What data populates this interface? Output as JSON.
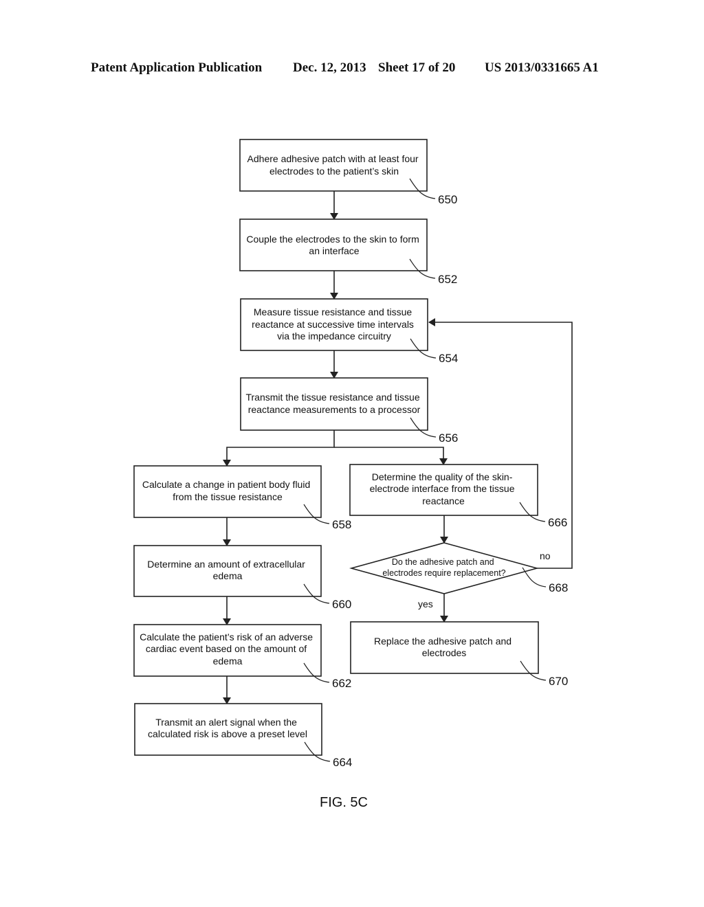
{
  "header": {
    "publication": "Patent Application Publication",
    "date": "Dec. 12, 2013",
    "sheet": "Sheet 17 of 20",
    "number": "US 2013/0331665 A1"
  },
  "steps": {
    "s650": {
      "ref": "650",
      "lines": [
        "Adhere adhesive patch with at least four",
        "electrodes to the patient’s skin"
      ]
    },
    "s652": {
      "ref": "652",
      "lines": [
        "Couple the electrodes to the skin to form",
        "an interface"
      ]
    },
    "s654": {
      "ref": "654",
      "lines": [
        "Measure tissue resistance and tissue",
        "reactance at successive time intervals",
        "via the impedance circuitry"
      ]
    },
    "s656": {
      "ref": "656",
      "lines": [
        "Transmit the tissue resistance and tissue",
        "reactance measurements to a processor"
      ]
    },
    "s658": {
      "ref": "658",
      "lines": [
        "Calculate a change in patient body fluid",
        "from the tissue resistance"
      ]
    },
    "s660": {
      "ref": "660",
      "lines": [
        "Determine an amount of extracellular",
        "edema"
      ]
    },
    "s662": {
      "ref": "662",
      "lines": [
        "Calculate the patient’s risk of an adverse",
        "cardiac event based on the amount of",
        "edema"
      ]
    },
    "s664": {
      "ref": "664",
      "lines": [
        "Transmit an alert signal when the",
        "calculated risk is above a preset level"
      ]
    },
    "s666": {
      "ref": "666",
      "lines": [
        "Determine the quality of the skin-",
        "electrode interface from the tissue",
        "reactance"
      ]
    },
    "s668": {
      "ref": "668",
      "lines": [
        "Do the adhesive patch and",
        "electrodes require replacement?"
      ]
    },
    "s670": {
      "ref": "670",
      "lines": [
        "Replace the adhesive patch and",
        "electrodes"
      ]
    }
  },
  "branch_labels": {
    "no": "no",
    "yes": "yes"
  },
  "figure_label": "FIG. 5C"
}
